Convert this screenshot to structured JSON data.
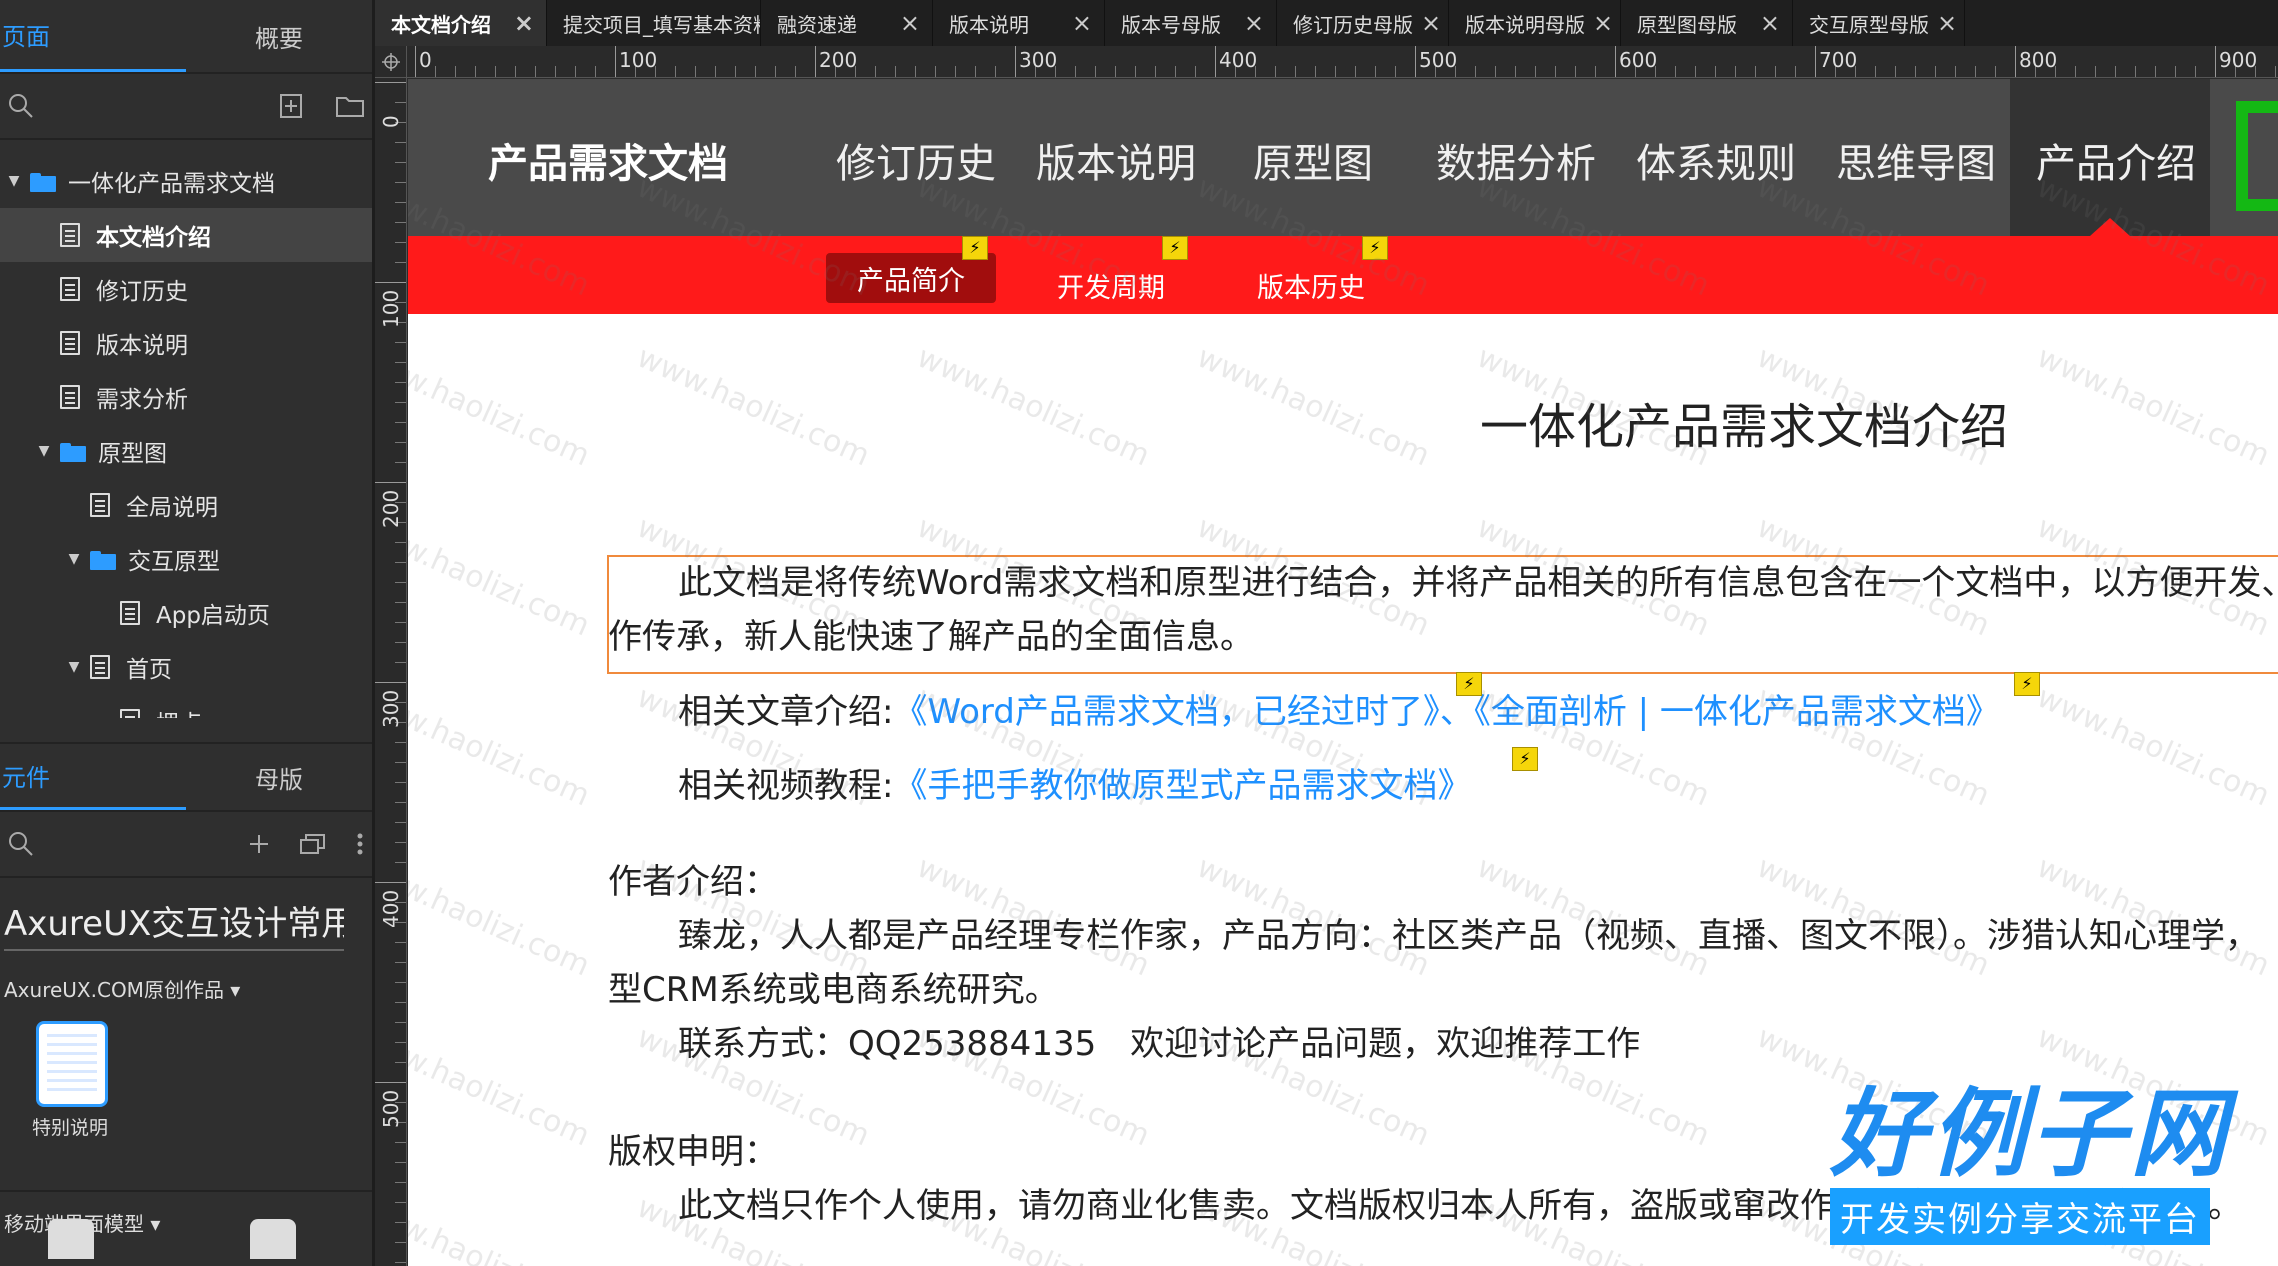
{
  "left_panel": {
    "pages_tab": "页面",
    "outline_tab": "概要",
    "tree": [
      {
        "label": "一体化产品需求文档",
        "type": "folder",
        "depth": 0,
        "expanded": true
      },
      {
        "label": "本文档介绍",
        "type": "page",
        "depth": 1,
        "selected": true
      },
      {
        "label": "修订历史",
        "type": "page",
        "depth": 1
      },
      {
        "label": "版本说明",
        "type": "page",
        "depth": 1
      },
      {
        "label": "需求分析",
        "type": "page",
        "depth": 1
      },
      {
        "label": "原型图",
        "type": "folder",
        "depth": 1,
        "expanded": true
      },
      {
        "label": "全局说明",
        "type": "page",
        "depth": 2
      },
      {
        "label": "交互原型",
        "type": "folder",
        "depth": 2,
        "expanded": true
      },
      {
        "label": "App启动页",
        "type": "page",
        "depth": 3
      },
      {
        "label": "首页",
        "type": "page",
        "depth": 2,
        "expanded": true
      },
      {
        "label": "埋点",
        "type": "page",
        "depth": 3
      }
    ],
    "widgets_tab": "元件",
    "masters_tab": "母版",
    "library_select": "AxureUX交互设计常用",
    "library_group_1": "AxureUX.COM原创作品 ▾",
    "widget_1_label": "特别说明",
    "library_group_2": "移动端界面模型 ▾"
  },
  "tabs": [
    {
      "label": "本文档介绍",
      "active": true
    },
    {
      "label": "提交项目_填写基本资料"
    },
    {
      "label": "融资速递"
    },
    {
      "label": "版本说明"
    },
    {
      "label": "版本号母版"
    },
    {
      "label": "修订历史母版"
    },
    {
      "label": "版本说明母版"
    },
    {
      "label": "原型图母版"
    },
    {
      "label": "交互原型母版"
    }
  ],
  "ruler": {
    "h_labels": [
      "0",
      "100",
      "200",
      "300",
      "400",
      "500",
      "600",
      "700",
      "800",
      "900"
    ],
    "v_labels": [
      "0",
      "100",
      "200",
      "300",
      "400",
      "500"
    ]
  },
  "site": {
    "title": "产品需求文档",
    "nav": [
      "修订历史",
      "版本说明",
      "原型图",
      "数据分析",
      "体系规则",
      "思维导图",
      "产品介绍"
    ],
    "active_nav": "产品介绍",
    "subnav": [
      "产品简介",
      "开发周期",
      "版本历史"
    ],
    "active_subnav": "产品简介"
  },
  "doc": {
    "title": "一体化产品需求文档介绍",
    "intro_line1": "此文档是将传统Word需求文档和原型进行结合，并将产品相关的所有信息包含在一个文档中，以方便开发、",
    "intro_line2": "作传承，新人能快速了解产品的全面信息。",
    "articles_label": "相关文章介绍:",
    "article_1": "《Word产品需求文档，已经过时了》",
    "article_sep": "、",
    "article_2": "《全面剖析 | 一体化产品需求文档》",
    "video_label": "相关视频教程:",
    "video_1": "《手把手教你做原型式产品需求文档》",
    "author_heading": "作者介绍：",
    "author_line1": "臻龙，人人都是产品经理专栏作家，产品方向：社区类产品（视频、直播、图文不限）。涉猎认知心理学，",
    "author_line2": "型CRM系统或电商系统研究。",
    "contact": "联系方式：QQ253884135　欢迎讨论产品问题，欢迎推荐工作",
    "copyright_heading": "版权申明：",
    "copyright_line1": "此文档只作个人使用，请勿商业化售卖。文档版权归本人所有，盗版或窜改作者信息后传播者必究责任。"
  },
  "watermark": "www.haolizi.com",
  "brand": {
    "name": "好例子网",
    "tagline": "开发实例分享交流平台"
  }
}
